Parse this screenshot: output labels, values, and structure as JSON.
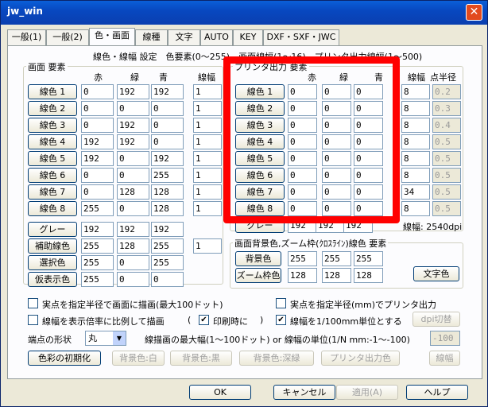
{
  "window": {
    "title": "jw_win",
    "close": "✕"
  },
  "tabs": [
    "一般(1)",
    "一般(2)",
    "色・画面",
    "線種",
    "文字",
    "AUTO",
    "KEY",
    "DXF・SXF・JWC"
  ],
  "header": "線色・線幅 設定　色要素(0〜255)　画面線幅(1〜16)　プリンタ出力線幅(1〜500)",
  "screen": {
    "title": "画面 要素",
    "cols": [
      "赤",
      "緑",
      "青",
      "線幅"
    ],
    "rows": [
      {
        "label": "線色 1",
        "r": "0",
        "g": "192",
        "b": "192",
        "w": "1"
      },
      {
        "label": "線色 2",
        "r": "0",
        "g": "0",
        "b": "0",
        "w": "1"
      },
      {
        "label": "線色 3",
        "r": "0",
        "g": "192",
        "b": "0",
        "w": "1"
      },
      {
        "label": "線色 4",
        "r": "192",
        "g": "192",
        "b": "0",
        "w": "1"
      },
      {
        "label": "線色 5",
        "r": "192",
        "g": "0",
        "b": "192",
        "w": "1"
      },
      {
        "label": "線色 6",
        "r": "0",
        "g": "0",
        "b": "255",
        "w": "1"
      },
      {
        "label": "線色 7",
        "r": "0",
        "g": "128",
        "b": "128",
        "w": "1"
      },
      {
        "label": "線色 8",
        "r": "255",
        "g": "0",
        "b": "128",
        "w": "1"
      },
      {
        "label": "グレー",
        "r": "192",
        "g": "192",
        "b": "192",
        "w": ""
      },
      {
        "label": "補助線色",
        "r": "255",
        "g": "128",
        "b": "255",
        "w": "1"
      },
      {
        "label": "選択色",
        "r": "255",
        "g": "0",
        "b": "255",
        "w": ""
      },
      {
        "label": "仮表示色",
        "r": "255",
        "g": "0",
        "b": "0",
        "w": ""
      }
    ]
  },
  "printer": {
    "title": "プリンタ出力 要素",
    "cols": [
      "赤",
      "緑",
      "青",
      "線幅",
      "点半径"
    ],
    "rows": [
      {
        "label": "線色 1",
        "r": "0",
        "g": "0",
        "b": "0",
        "w": "8",
        "p": "0.2"
      },
      {
        "label": "線色 2",
        "r": "0",
        "g": "0",
        "b": "0",
        "w": "8",
        "p": "0.3"
      },
      {
        "label": "線色 3",
        "r": "0",
        "g": "0",
        "b": "0",
        "w": "8",
        "p": "0.4"
      },
      {
        "label": "線色 4",
        "r": "0",
        "g": "0",
        "b": "0",
        "w": "8",
        "p": "0.5"
      },
      {
        "label": "線色 5",
        "r": "0",
        "g": "0",
        "b": "0",
        "w": "8",
        "p": "0.5"
      },
      {
        "label": "線色 6",
        "r": "0",
        "g": "0",
        "b": "0",
        "w": "8",
        "p": "0.5"
      },
      {
        "label": "線色 7",
        "r": "0",
        "g": "0",
        "b": "0",
        "w": "34",
        "p": "0.5"
      },
      {
        "label": "線色 8",
        "r": "0",
        "g": "0",
        "b": "0",
        "w": "8",
        "p": "0.5"
      }
    ],
    "gray": {
      "label": "グレー",
      "r": "192",
      "g": "192",
      "b": "192"
    },
    "linewidth_note": "線幅: 2540dpi"
  },
  "bg": {
    "title": "画面背景色,ズーム枠(ｸﾛｽﾗｲﾝ)線色 要素",
    "rows": [
      {
        "label": "背景色",
        "r": "255",
        "g": "255",
        "b": "255"
      },
      {
        "label": "ズーム枠色",
        "r": "128",
        "g": "128",
        "b": "128"
      }
    ],
    "text_color_btn": "文字色"
  },
  "options": {
    "draw_point_radius": "実点を指定半径で画面に描画(最大100ドット)",
    "print_point_mm": "実点を指定半径(mm)でプリンタ出力",
    "scale_linewidth": "線幅を表示倍率に比例して描画",
    "print_paren_open": "(",
    "on_print": "印刷時に",
    "print_paren_close": ")",
    "linewidth_100mm": "線幅を1/100mm単位とする",
    "dpi_btn": "dpi切替",
    "endpoint_label": "端点の形状",
    "endpoint_value": "丸",
    "max_width_label": "線描画の最大幅(1〜100ドット) or 線幅の単位(1/N mm:-1〜-100)",
    "max_width_value": "-100"
  },
  "bottom_btns": [
    "色彩の初期化",
    "背景色:白",
    "背景色:黒",
    "背景色:深緑",
    "プリンタ出力色",
    "線幅"
  ],
  "dialog_btns": [
    "OK",
    "キャンセル",
    "適用(A)",
    "ヘルプ"
  ]
}
